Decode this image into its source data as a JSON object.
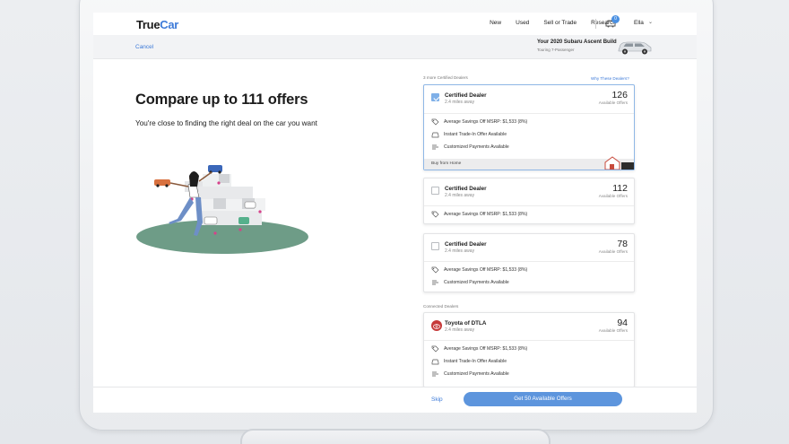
{
  "nav": {
    "logo_part1": "True",
    "logo_part2": "Car",
    "links": [
      "New",
      "Used",
      "Sell or Trade",
      "Research"
    ],
    "cart_count": "0",
    "user_name": "Ella",
    "user_chevron": "⌄"
  },
  "subbar": {
    "cancel_label": "Cancel",
    "build_title": "Your 2020 Subaru Ascent Build",
    "build_subtitle": "Touring 7-Passenger"
  },
  "hero": {
    "title": "Compare up to 111 offers",
    "subtitle": "You're close to finding the right deal on the car you want"
  },
  "certified_section": {
    "label": "3 more Certified Dealers",
    "why_link": "Why These Dealers?"
  },
  "connected_section": {
    "label": "Connected Dealers"
  },
  "dealers": [
    {
      "name": "Certified Dealer",
      "distance": "2.4 miles away",
      "count": "126",
      "count_label": "Available Offers",
      "selected": true,
      "features": [
        {
          "icon": "tag-icon",
          "text": "Average Savings Off MSRP: $1,533 (8%)"
        },
        {
          "icon": "trade-in-icon",
          "text": "Instant Trade-In Offer Available"
        },
        {
          "icon": "payments-icon",
          "text": "Customized Payments Available"
        }
      ],
      "footer": "Buy from Home"
    },
    {
      "name": "Certified Dealer",
      "distance": "2.4 miles away",
      "count": "112",
      "count_label": "Available Offers",
      "selected": false,
      "features": [
        {
          "icon": "tag-icon",
          "text": "Average Savings Off MSRP: $1,533 (8%)"
        }
      ]
    },
    {
      "name": "Certified Dealer",
      "distance": "2.4 miles away",
      "count": "78",
      "count_label": "Available Offers",
      "selected": false,
      "features": [
        {
          "icon": "tag-icon",
          "text": "Average Savings Off MSRP: $1,533 (8%)"
        },
        {
          "icon": "payments-icon",
          "text": "Customized Payments Available"
        }
      ]
    },
    {
      "name": "Toyota of DTLA",
      "distance": "2.4 miles away",
      "count": "94",
      "count_label": "Available Offers",
      "selected": false,
      "features": [
        {
          "icon": "tag-icon",
          "text": "Average Savings Off MSRP: $1,533 (8%)"
        },
        {
          "icon": "trade-in-icon",
          "text": "Instant Trade-In Offer Available"
        },
        {
          "icon": "payments-icon",
          "text": "Customized Payments Available"
        }
      ]
    }
  ],
  "footer": {
    "skip_label": "Skip",
    "cta_label": "Get 50 Available Offers"
  },
  "colors": {
    "brand_blue": "#3d7ad8",
    "cta_blue": "#5d95dd",
    "check_blue": "#7fb0e8",
    "ground_green": "#6e9c87"
  }
}
